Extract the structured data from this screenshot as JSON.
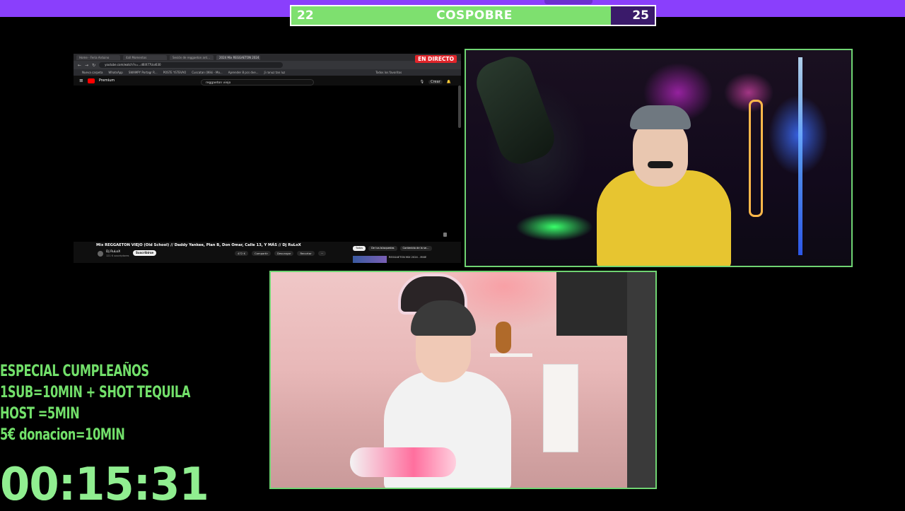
{
  "score_bar": {
    "left_score": "22",
    "title": "COSPOBRE",
    "right_score": "25",
    "left_color": "#7ee06f",
    "right_color": "#3a1a6a",
    "top_bar_color": "#8a3ffc"
  },
  "screen_share": {
    "live_badge": "EN DIRECTO",
    "browser": {
      "tabs": [
        "Home - Feria Arduino",
        "4all Momentos",
        "Sesión de reggaeton ant…",
        "2024 Mix REGGAETON 2024"
      ],
      "url": "youtube.com/watch?v=...d6lX77Uoi630",
      "bookmarks": [
        "Nueva carpeta",
        "WhatsApp",
        "SWAMPY Portagr R...",
        "POSTE YSTEVAO",
        "Cuscatan (Wiki - Mo...",
        "Aprender 8 pcs dve...",
        "Ji ranuz tan luz",
        "Todos los favoritos"
      ]
    },
    "youtube": {
      "brand": "Premium",
      "search_value": "reggaeton viejo",
      "create_label": "Crear",
      "video_title": "Mix REGGAETON VIEJO (Old School) // Daddy Yankee, Plan B, Don Omar, Calle 13, Y MÁS // Dj RuLoX",
      "channel_name": "Dj RuLoX",
      "channel_subs": "121 K suscriptores",
      "subscribe_label": "Suscribirse",
      "likes": "472 K",
      "share_label": "Compartir",
      "download_label": "Descargar",
      "clip_label": "Recortar",
      "more_label": "···",
      "chips": [
        "Todos",
        "De tus búsquedas",
        "Contenido de la se..."
      ],
      "rec_title": "REGGAETON MIX 2024 - MIXE"
    }
  },
  "promo_lines": {
    "line1": "ESPECIAL CUMPLEAÑOS",
    "line2": "1SUB=10MIN + SHOT TEQUILA",
    "line3": "HOST =5MIN",
    "line4": "5€ donacion=10MIN"
  },
  "timer": "00:15:31",
  "colors": {
    "cam_border": "#6fd472",
    "promo_text": "#72e06a",
    "timer_text": "#90ee90",
    "live_badge": "#e0242a"
  }
}
